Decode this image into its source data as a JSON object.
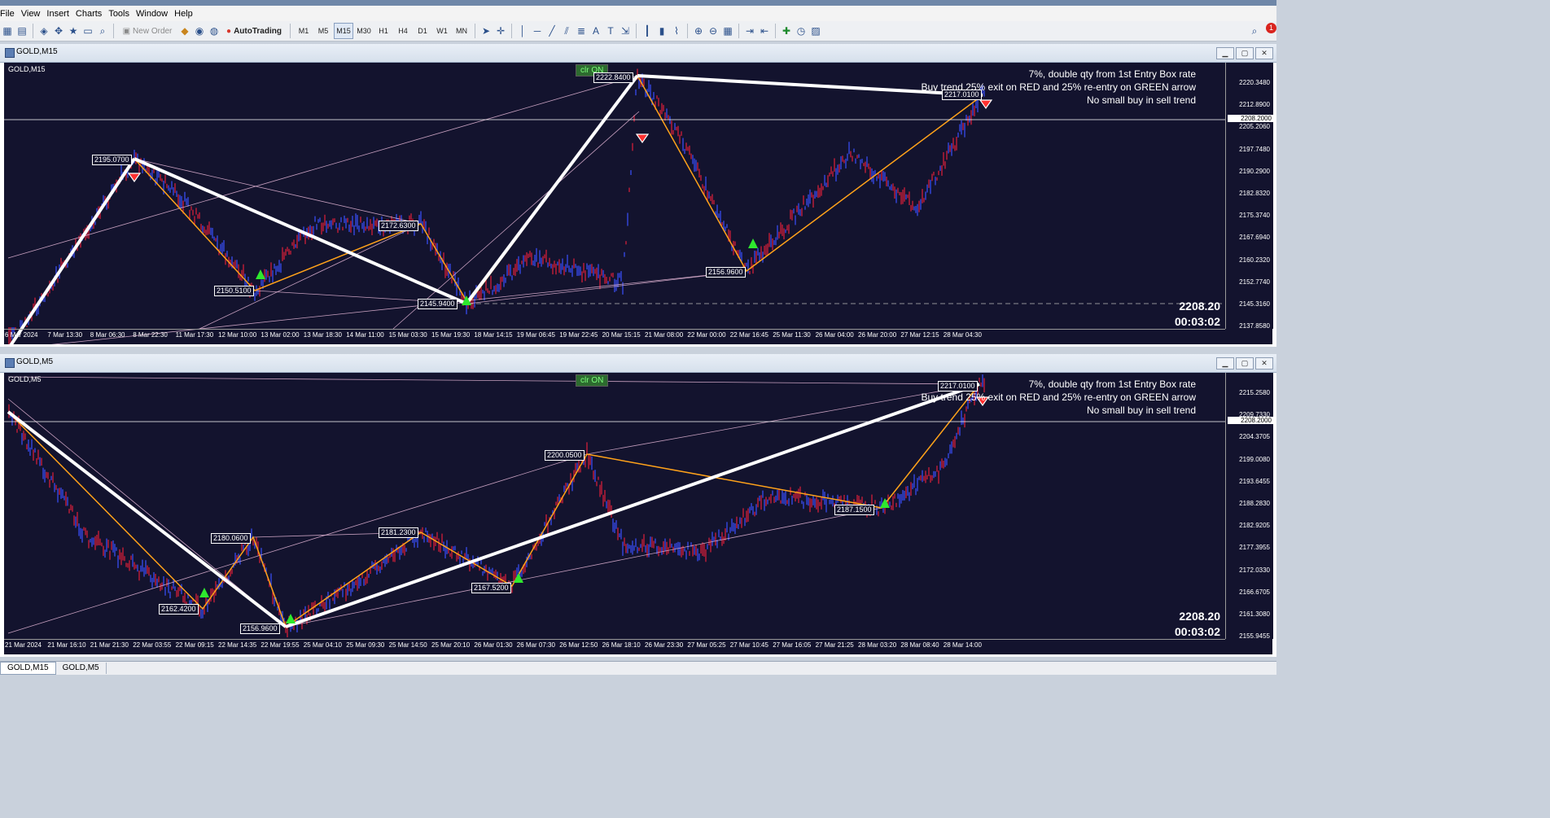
{
  "menu": [
    "File",
    "View",
    "Insert",
    "Charts",
    "Tools",
    "Window",
    "Help"
  ],
  "toolbar": {
    "new_order": "New Order",
    "autotrading": "AutoTrading",
    "timeframes": [
      "M1",
      "M5",
      "M15",
      "M30",
      "H1",
      "H4",
      "D1",
      "W1",
      "MN"
    ],
    "active_timeframe": "M15",
    "notification_count": "1"
  },
  "windows": [
    {
      "title": "GOLD,M15",
      "symbol_label": "GOLD,M15",
      "clr_label": "clr ON",
      "notes": [
        "7%,   double qty from 1st Entry Box rate",
        "Buy trend 25% exit on RED and 25% re-entry on GREEN arrow",
        "No small  buy in sell trend"
      ],
      "price": "2208.20",
      "timer": "00:03:02",
      "current_price_box": "2208.2000",
      "price_ticks": [
        "2220.3480",
        "2212.8900",
        "2205.2060",
        "2197.7480",
        "2190.2900",
        "2182.8320",
        "2175.3740",
        "2167.6940",
        "2160.2320",
        "2152.7740",
        "2145.3160",
        "2137.8580"
      ],
      "time_ticks": [
        "6 Mar 2024",
        "7 Mar 13:30",
        "8 Mar 06:30",
        "8 Mar 22:30",
        "11 Mar 17:30",
        "12 Mar 10:00",
        "13 Mar 02:00",
        "13 Mar 18:30",
        "14 Mar 11:00",
        "15 Mar 03:30",
        "15 Mar 19:30",
        "18 Mar 14:15",
        "19 Mar 06:45",
        "19 Mar 22:45",
        "20 Mar 15:15",
        "21 Mar 08:00",
        "22 Mar 00:00",
        "22 Mar 16:45",
        "25 Mar 11:30",
        "26 Mar 04:00",
        "26 Mar 20:00",
        "27 Mar 12:15",
        "28 Mar 04:30"
      ],
      "swing_labels": [
        "2195.0700",
        "2222.8400",
        "2172.6300",
        "2150.5100",
        "2145.9400",
        "2156.9600",
        "2217.0100"
      ]
    },
    {
      "title": "GOLD,M5",
      "symbol_label": "GOLD,M5",
      "clr_label": "clr ON",
      "notes": [
        "7%,   double qty from 1st Entry Box rate",
        "Buy trend 25% exit on RED and 25% re-entry on GREEN arrow",
        "No small  buy in sell trend"
      ],
      "price": "2208.20",
      "timer": "00:03:02",
      "current_price_box": "2208.2000",
      "price_ticks": [
        "2215.2580",
        "2209.7330",
        "2204.3705",
        "2199.0080",
        "2193.6455",
        "2188.2830",
        "2182.9205",
        "2177.3955",
        "2172.0330",
        "2166.6705",
        "2161.3080",
        "2155.9455"
      ],
      "time_ticks": [
        "21 Mar 2024",
        "21 Mar 16:10",
        "21 Mar 21:30",
        "22 Mar 03:55",
        "22 Mar 09:15",
        "22 Mar 14:35",
        "22 Mar 19:55",
        "25 Mar 04:10",
        "25 Mar 09:30",
        "25 Mar 14:50",
        "25 Mar 20:10",
        "26 Mar 01:30",
        "26 Mar 07:30",
        "26 Mar 12:50",
        "26 Mar 18:10",
        "26 Mar 23:30",
        "27 Mar 05:25",
        "27 Mar 10:45",
        "27 Mar 16:05",
        "27 Mar 21:25",
        "28 Mar 03:20",
        "28 Mar 08:40",
        "28 Mar 14:00"
      ],
      "swing_labels": [
        "2217.0100",
        "2200.0500",
        "2180.0600",
        "2181.2300",
        "2187.1500",
        "2167.5200",
        "2162.4200",
        "2156.9600"
      ]
    }
  ],
  "tabs": [
    "GOLD,M15",
    "GOLD,M5"
  ],
  "colors": {
    "chart_bg": "#13132e",
    "zigzag": "#ffa21a",
    "trend": "#ffffff",
    "candle_up": "#3a50ff",
    "candle_down": "#e0203a",
    "thin_line": "#e6b8d8",
    "buy_arrow": "#2ee82e",
    "sell_arrow": "#ff3030"
  }
}
